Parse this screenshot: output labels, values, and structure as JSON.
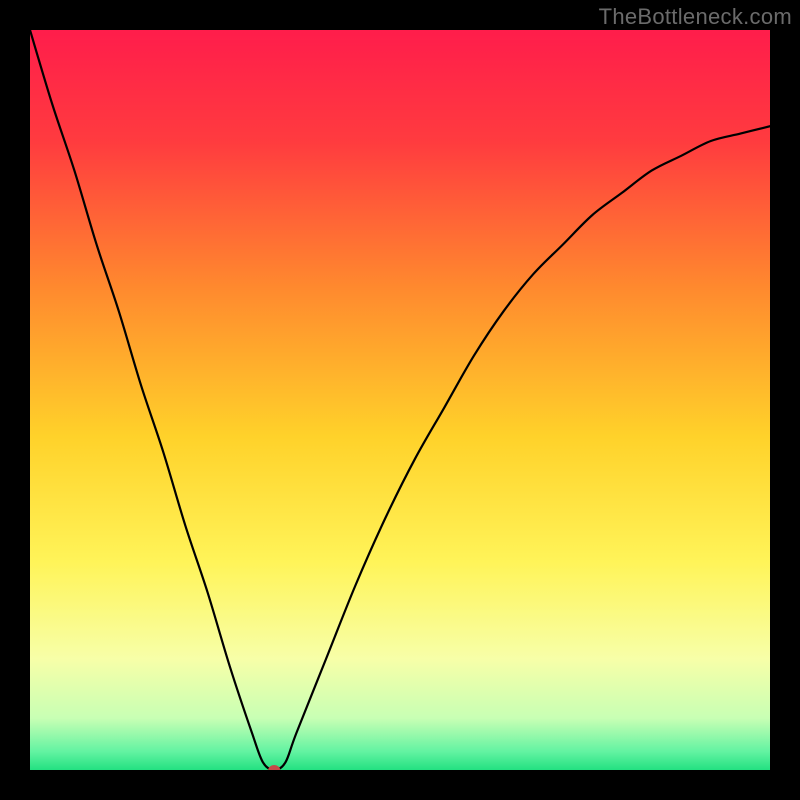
{
  "watermark": {
    "text": "TheBottleneck.com"
  },
  "chart_data": {
    "type": "line",
    "title": "",
    "xlabel": "",
    "ylabel": "",
    "xlim": [
      0,
      100
    ],
    "ylim": [
      0,
      100
    ],
    "grid": false,
    "legend": false,
    "background_gradient": {
      "stops": [
        {
          "pos": 0.0,
          "color": "#ff1d4b"
        },
        {
          "pos": 0.15,
          "color": "#ff3b3f"
        },
        {
          "pos": 0.35,
          "color": "#ff8a2e"
        },
        {
          "pos": 0.55,
          "color": "#ffd22a"
        },
        {
          "pos": 0.72,
          "color": "#fff459"
        },
        {
          "pos": 0.85,
          "color": "#f7ffa8"
        },
        {
          "pos": 0.93,
          "color": "#c8ffb4"
        },
        {
          "pos": 0.975,
          "color": "#63f3a2"
        },
        {
          "pos": 1.0,
          "color": "#23e181"
        }
      ]
    },
    "series": [
      {
        "name": "bottleneck-curve",
        "x": [
          0,
          3,
          6,
          9,
          12,
          15,
          18,
          21,
          24,
          27,
          30,
          31.5,
          33,
          34.5,
          36,
          40,
          44,
          48,
          52,
          56,
          60,
          64,
          68,
          72,
          76,
          80,
          84,
          88,
          92,
          96,
          100
        ],
        "y": [
          100,
          90,
          81,
          71,
          62,
          52,
          43,
          33,
          24,
          14,
          5,
          1,
          0,
          1,
          5,
          15,
          25,
          34,
          42,
          49,
          56,
          62,
          67,
          71,
          75,
          78,
          81,
          83,
          85,
          86,
          87
        ]
      }
    ],
    "marker": {
      "name": "min-point",
      "x": 33,
      "y": 0,
      "color": "#c54a48",
      "rx": 6,
      "ry": 5
    }
  }
}
